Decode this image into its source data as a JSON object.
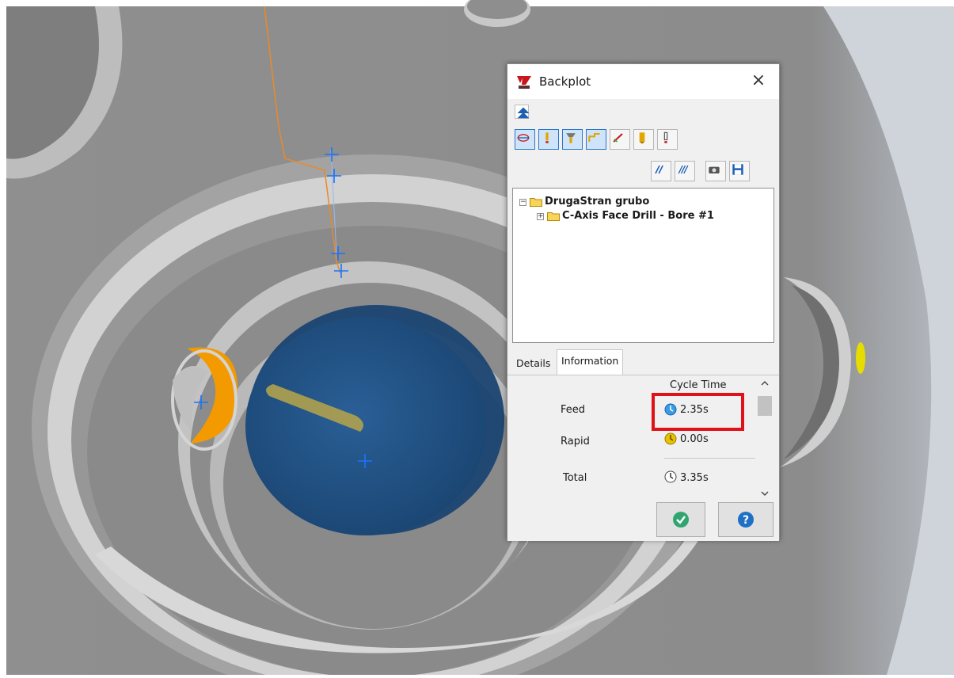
{
  "dialog": {
    "title": "Backplot",
    "close_glyph": "×"
  },
  "tree": {
    "root": {
      "label": "DrugaStran grubo",
      "expander": "−"
    },
    "child": {
      "label": "C-Axis Face Drill - Bore #1",
      "expander": "+"
    }
  },
  "tabs": {
    "details": "Details",
    "information": "Information"
  },
  "info": {
    "header": "Cycle Time",
    "rows": [
      {
        "label": "Feed",
        "value": "2.35s",
        "icon": "feed-clock-icon"
      },
      {
        "label": "Rapid",
        "value": "0.00s",
        "icon": "rapid-clock-icon"
      },
      {
        "label": "Total",
        "value": "3.35s",
        "icon": "total-clock-icon"
      }
    ]
  },
  "footer": {
    "ok_icon": "check-icon",
    "help_icon": "help-icon"
  },
  "colors": {
    "highlight": "#e0111b",
    "toolbar_active": "#2a78c8",
    "ok_green": "#2fa66f",
    "help_blue": "#1f6fc5",
    "part_gray": "#8c8c8c",
    "tool_blue": "#1e4f84",
    "insert_orange": "#f39a00",
    "toolpath_blue": "#1874ff",
    "toolpath_orange": "#e98a2a"
  }
}
